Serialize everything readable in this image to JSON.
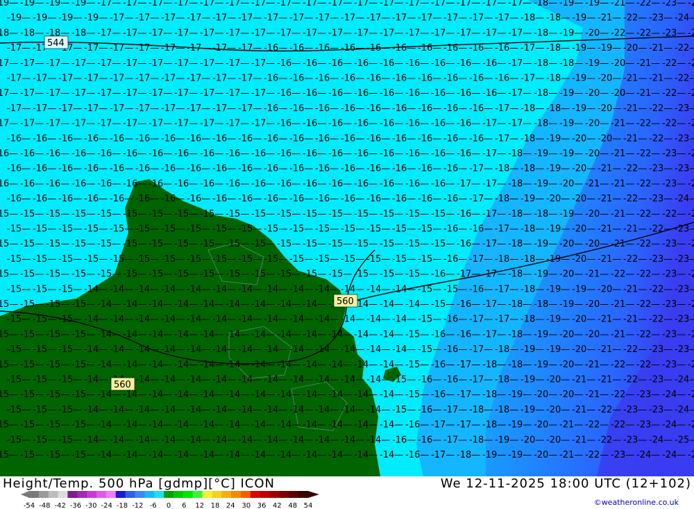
{
  "header": {
    "title": "Height/Temp. 500 hPa [gdmp][°C] ICON",
    "valid_time": "We 12-11-2025 18:00 UTC (12+102)"
  },
  "credit": "©weatheronline.co.uk",
  "height_labels": [
    "544",
    "560",
    "560"
  ],
  "legend": {
    "ticks": [
      "-54",
      "-48",
      "-42",
      "-36",
      "-30",
      "-24",
      "-18",
      "-12",
      "-6",
      "0",
      "6",
      "12",
      "18",
      "24",
      "30",
      "36",
      "42",
      "48",
      "54"
    ],
    "colors": [
      "#7a7a7a",
      "#9a9a9a",
      "#bdbdbd",
      "#dcdcdc",
      "#7a1f8c",
      "#a12bb3",
      "#c83ad8",
      "#e05ae8",
      "#f07ef5",
      "#1a1ad0",
      "#2f5fe6",
      "#3f86f2",
      "#1fb5f5",
      "#1fe0e8",
      "#00a000",
      "#00c800",
      "#00e600",
      "#3df13d",
      "#f2f230",
      "#f4d220",
      "#f4b010",
      "#f48a00",
      "#f45c00",
      "#e20000",
      "#c00000",
      "#9e0000",
      "#7c0000",
      "#5a0000",
      "#3a0000"
    ]
  },
  "map": {
    "colors": {
      "cyan": "#00ecfc",
      "light_blue": "#14b6ff",
      "mid_blue": "#1e8cff",
      "blue": "#2a64ff",
      "deep_blue": "#3a3cf0",
      "green": "#006400"
    }
  }
}
